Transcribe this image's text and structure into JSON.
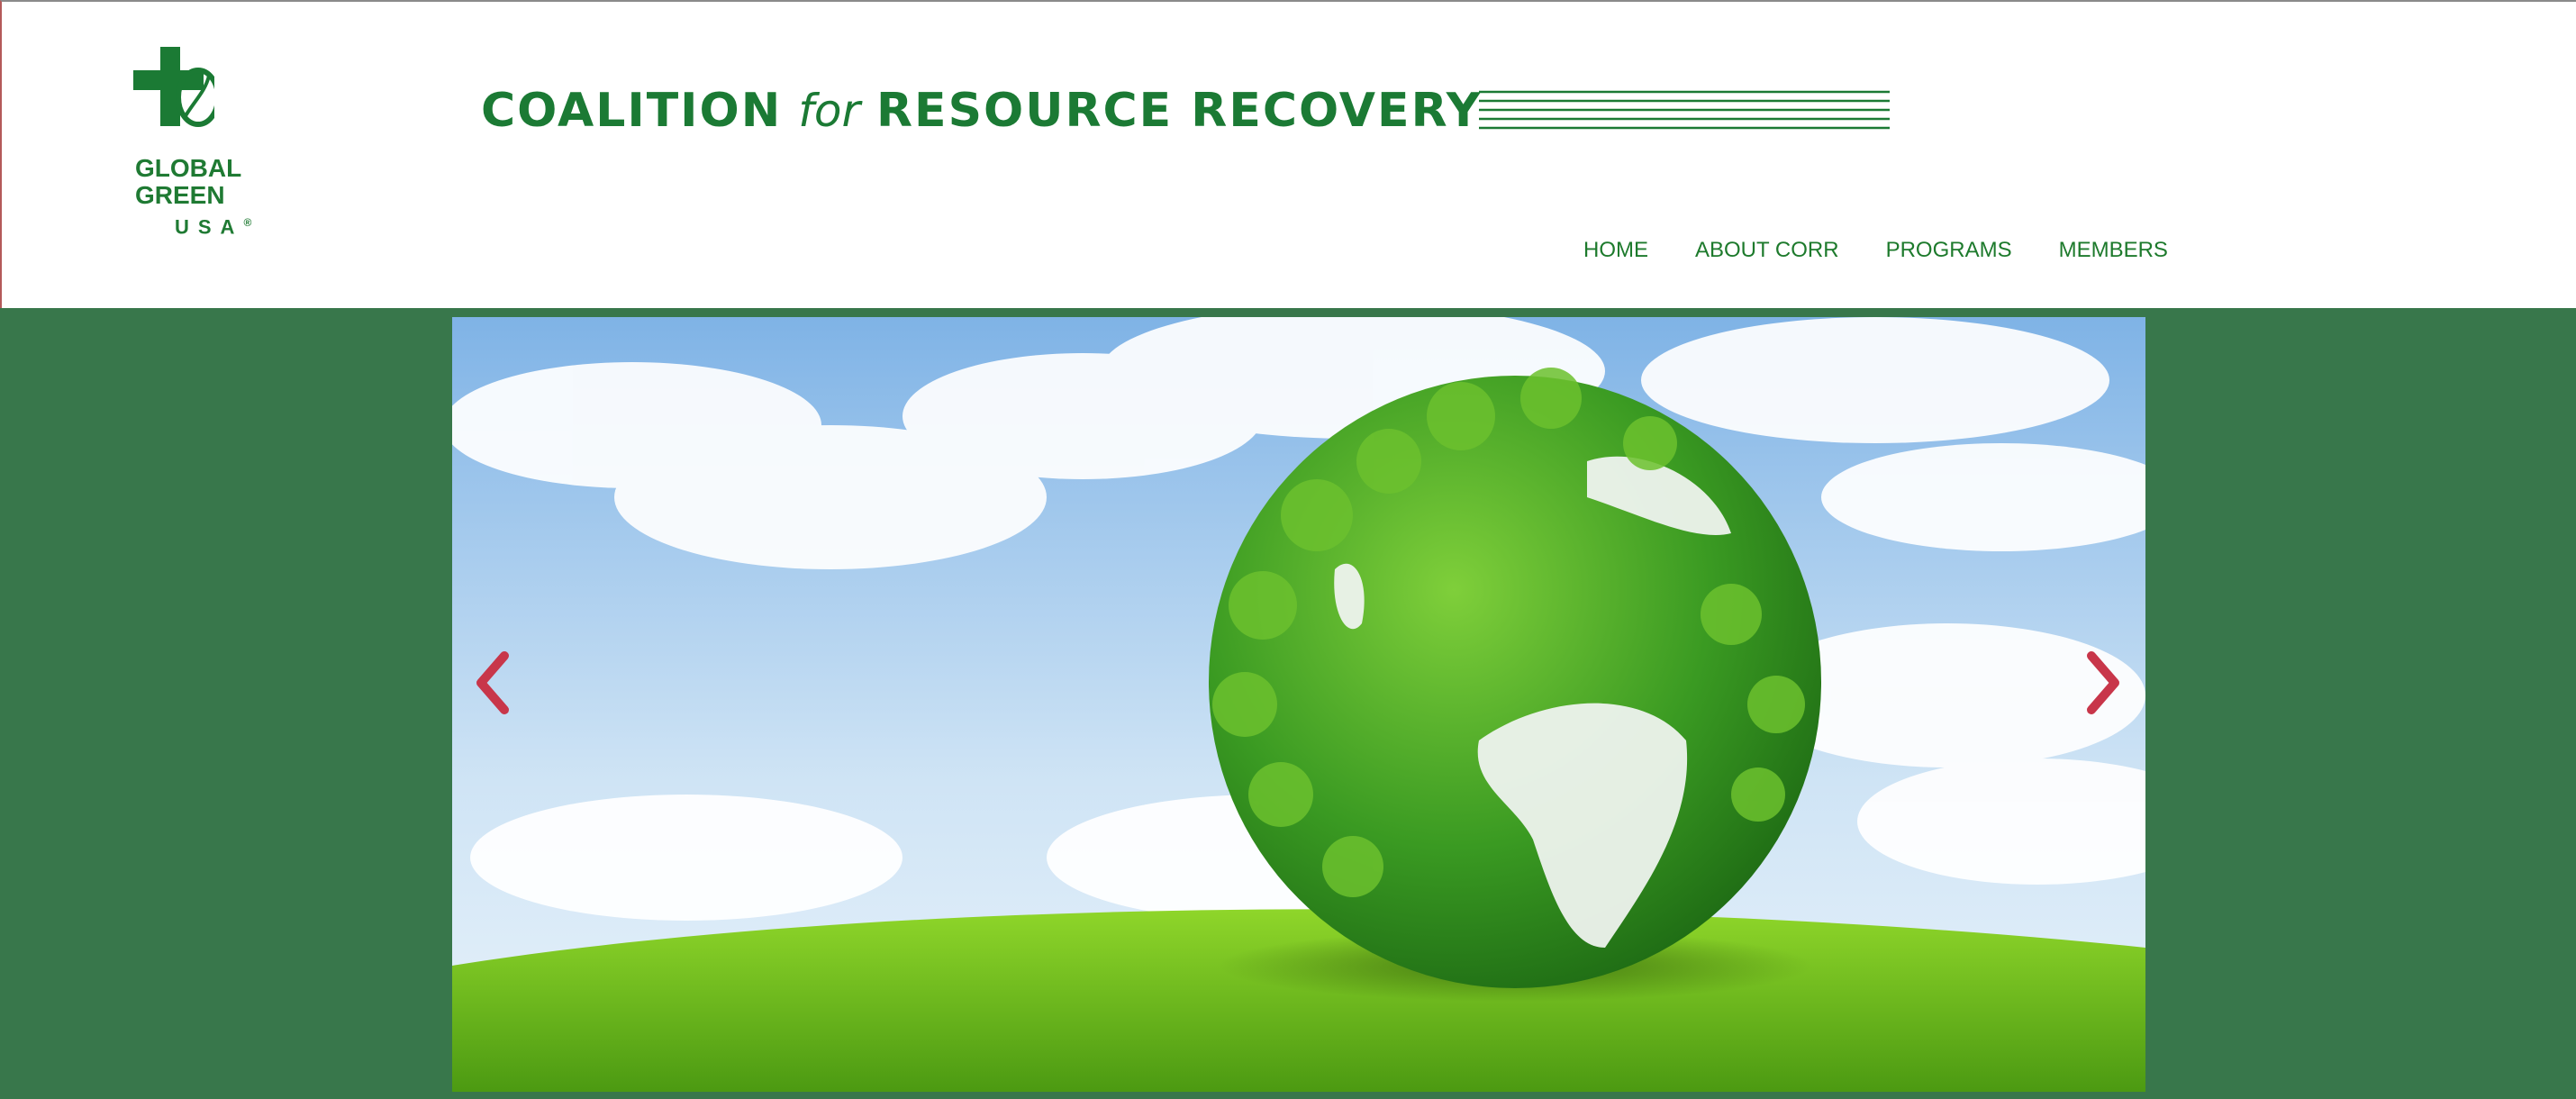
{
  "logo": {
    "line1": "GLOBAL",
    "line2": "GREEN",
    "line3": "USA",
    "mark": "®"
  },
  "brand": {
    "part1": "COALITION",
    "part2": "for",
    "part3": "RESOURCE RECOVERY"
  },
  "nav": {
    "items": [
      {
        "label": "HOME"
      },
      {
        "label": "ABOUT CORR"
      },
      {
        "label": "PROGRAMS"
      },
      {
        "label": "MEMBERS"
      }
    ]
  },
  "carousel": {
    "slide_image": "leafy green globe on grassy hill under blue sky",
    "prev_icon": "chevron-left-icon",
    "next_icon": "chevron-right-icon",
    "arrow_color": "#c8364a"
  },
  "colors": {
    "brand_green": "#1b7a34",
    "page_background": "#38774b"
  }
}
